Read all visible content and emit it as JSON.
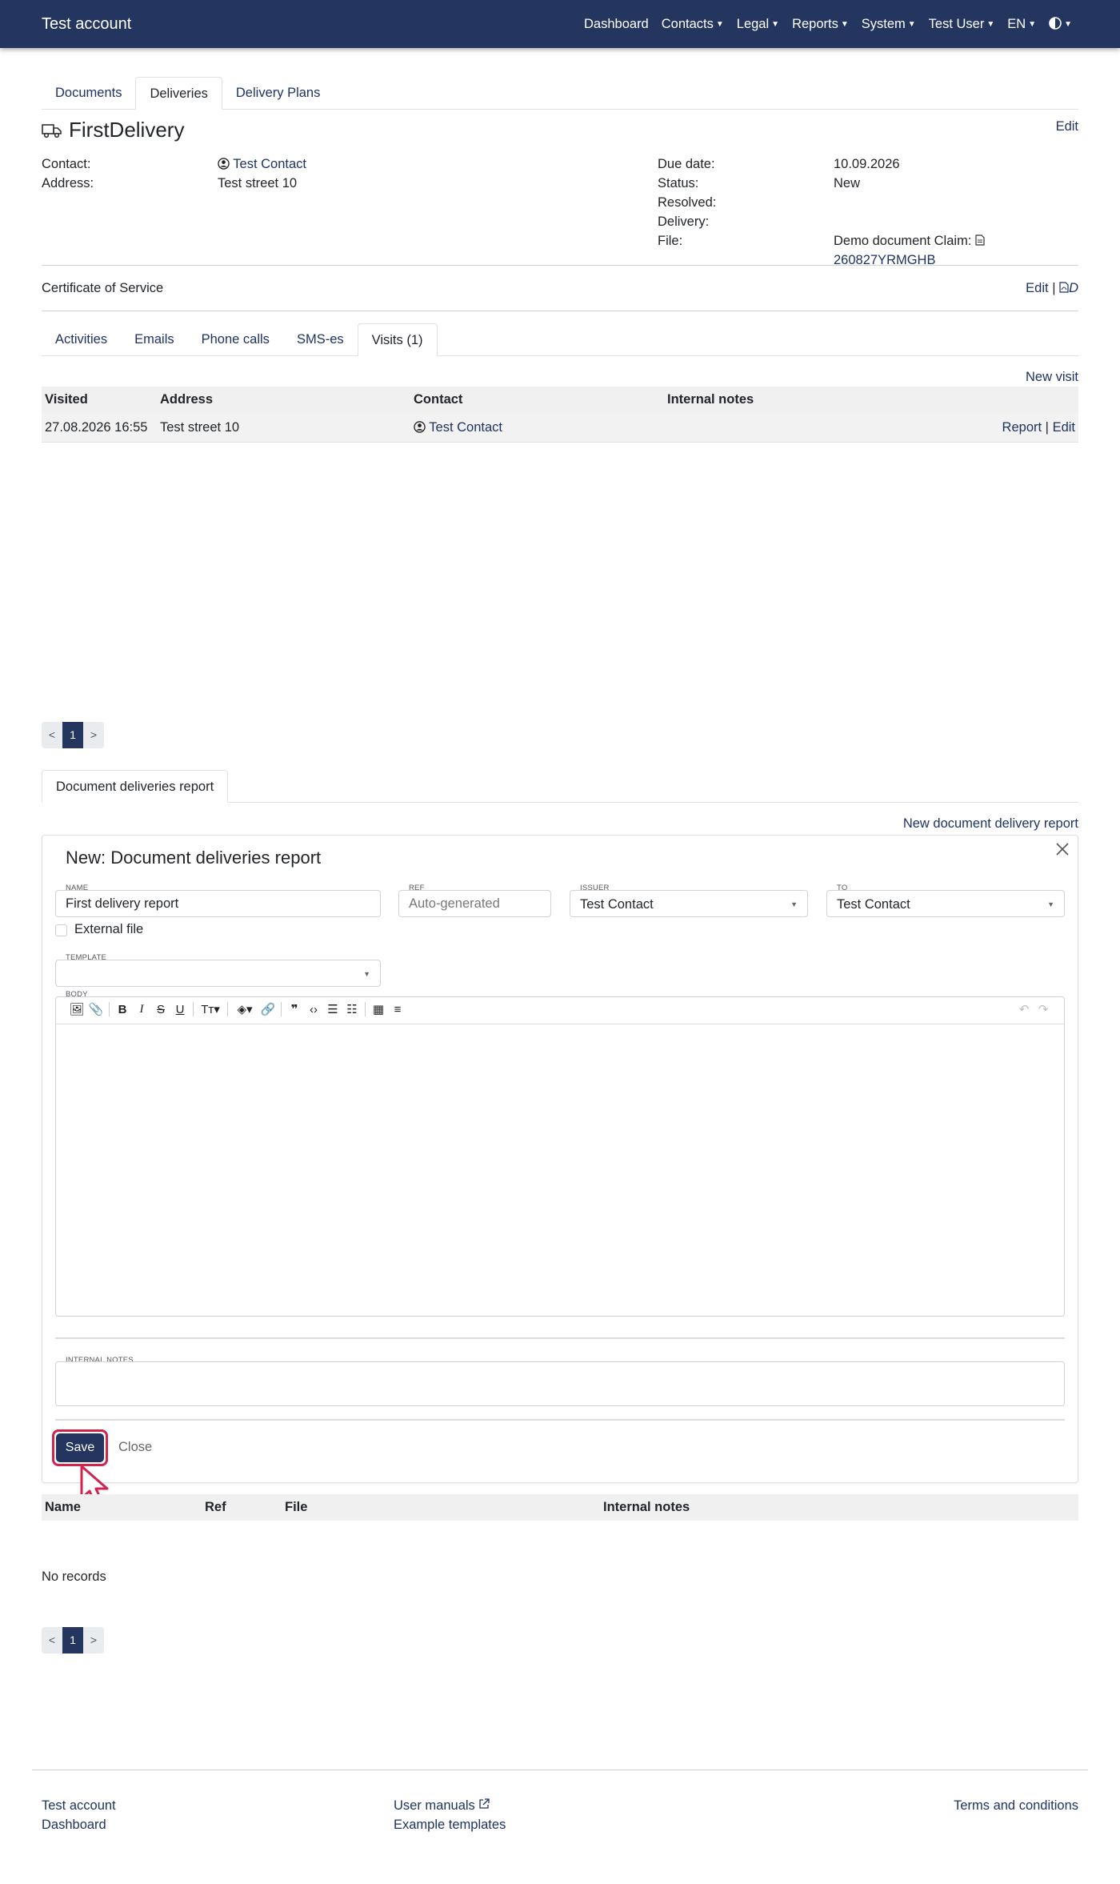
{
  "navbar": {
    "brand": "Test account",
    "items": [
      "Dashboard",
      "Contacts",
      "Legal",
      "Reports",
      "System",
      "Test User",
      "EN"
    ]
  },
  "tabs_top": [
    "Documents",
    "Deliveries",
    "Delivery Plans"
  ],
  "delivery": {
    "title": "FirstDelivery",
    "edit": "Edit",
    "contact_label": "Contact:",
    "contact_value": "Test Contact",
    "address_label": "Address:",
    "address_value": "Test street 10",
    "due_label": "Due date:",
    "due_value": "10.09.2026",
    "status_label": "Status:",
    "status_value": "New",
    "resolved_label": "Resolved:",
    "delivery_label": "Delivery:",
    "file_label": "File:",
    "file_value_1": "Demo document Claim:",
    "file_value_2": "260827YRMGHB"
  },
  "certificate": {
    "label": "Certificate of Service",
    "edit": "Edit",
    "sep": "|",
    "pdf": "D"
  },
  "tabs_activity": [
    "Activities",
    "Emails",
    "Phone calls",
    "SMS-es",
    "Visits (1)"
  ],
  "visits": {
    "new_link": "New visit",
    "columns": [
      "Visited",
      "Address",
      "Contact",
      "Internal notes"
    ],
    "rows": [
      {
        "visited": "27.08.2026 16:55",
        "address": "Test street 10",
        "contact": "Test Contact",
        "report": "Report",
        "sep": "|",
        "edit": "Edit"
      }
    ]
  },
  "pager": {
    "prev": "<",
    "page": "1",
    "next": ">"
  },
  "report_tab": "Document deliveries report",
  "report": {
    "new_link": "New document delivery report",
    "form_title": "New: Document deliveries report",
    "name_label": "NAME",
    "name_value": "First delivery report",
    "ref_label": "REF",
    "ref_placeholder": "Auto-generated",
    "issuer_label": "ISSUER",
    "issuer_value": "Test Contact",
    "to_label": "TO",
    "to_value": "Test Contact",
    "external_file": "External file",
    "template_label": "TEMPLATE",
    "body_label": "BODY",
    "internal_notes_label": "INTERNAL NOTES",
    "save": "Save",
    "close": "Close"
  },
  "reports_table": {
    "columns": [
      "Name",
      "Ref",
      "File",
      "Internal notes"
    ],
    "empty": "No records"
  },
  "footer": {
    "col1": [
      "Test account",
      "Dashboard"
    ],
    "col2": [
      "User manuals",
      "Example templates"
    ],
    "col3": [
      "Terms and conditions"
    ]
  }
}
